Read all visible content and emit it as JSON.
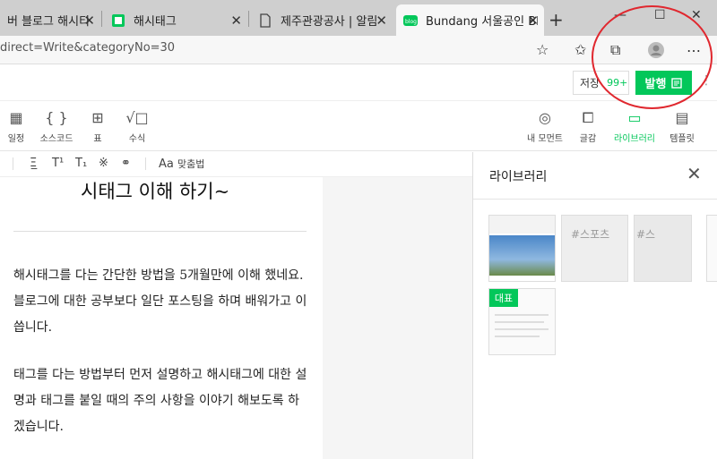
{
  "browser": {
    "tabs": [
      {
        "title": "버 블로그 해시티",
        "active": false
      },
      {
        "title": "해시태그",
        "active": false
      },
      {
        "title": "제주관광공사 | 알림미",
        "active": false
      },
      {
        "title": "Bundang 서울공인 Bl",
        "active": true
      }
    ],
    "url": "direct=Write&categoryNo=30"
  },
  "editor_toolbar": {
    "save_label": "저장",
    "save_count": "99+",
    "publish_label": "발행"
  },
  "insert_tools": [
    {
      "label": "일정",
      "icon": "calendar-icon"
    },
    {
      "label": "소스코드",
      "icon": "braces-icon"
    },
    {
      "label": "표",
      "icon": "table-icon"
    },
    {
      "label": "수식",
      "icon": "formula-icon"
    }
  ],
  "right_tools": [
    {
      "label": "내 모먼트",
      "icon": "moment-icon"
    },
    {
      "label": "글감",
      "icon": "book-search-icon"
    },
    {
      "label": "라이브러리",
      "icon": "archive-icon",
      "active": true
    },
    {
      "label": "템플릿",
      "icon": "template-icon"
    }
  ],
  "format_bar": {
    "spellcheck_label": "맞춤법"
  },
  "post": {
    "heading": "시태그 이해 하기~",
    "paragraph1": "해시태그를 다는 간단한 방법을 5개월만에 이해 했네요. 블로그에 대한 공부보다 일단 포스팅을 하며 배워가고 이씁니다.",
    "paragraph2": "태그를 다는 방법부터 먼저 설명하고 해시태그에 대한 설명과 태그를 붙일 때의 주의 사항을 이야기 해보도록 하겠습니다."
  },
  "library": {
    "title": "라이브러리",
    "badge": "대표",
    "tag1": "#스포츠",
    "tag2": "#스"
  },
  "colors": {
    "accent": "#03c75a",
    "annotation": "#e0282f"
  }
}
